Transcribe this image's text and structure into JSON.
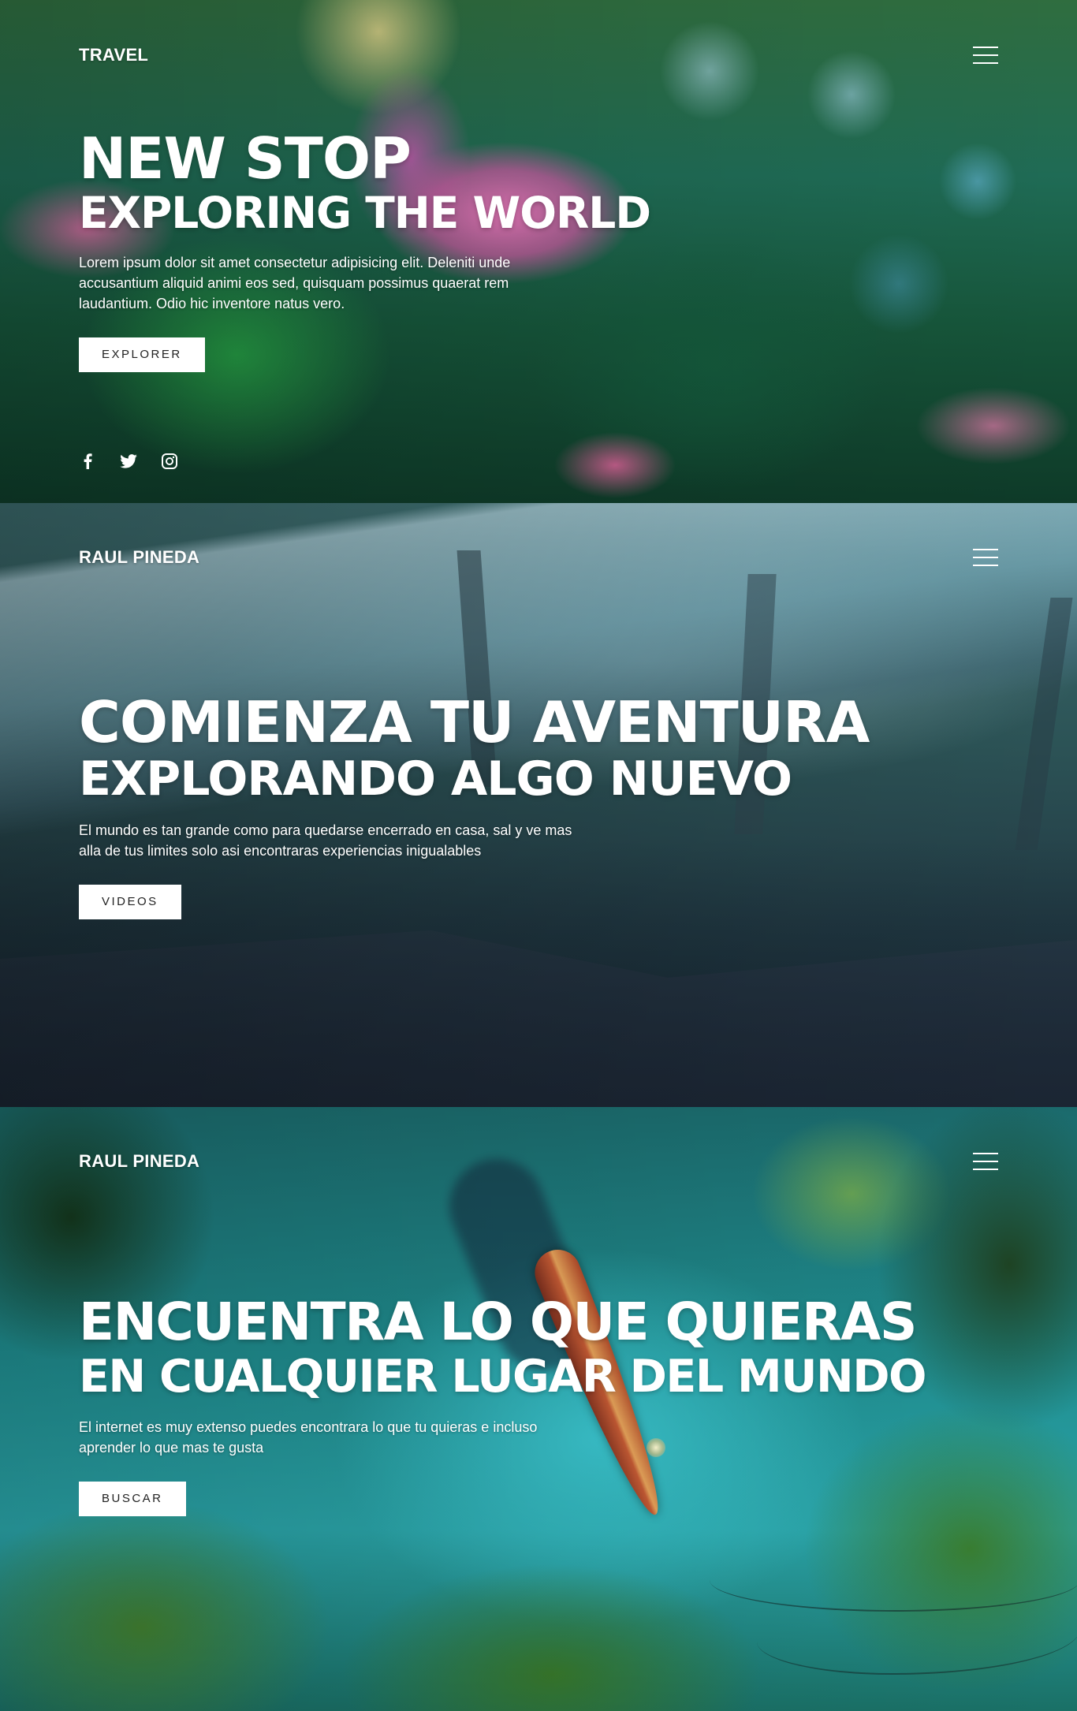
{
  "sections": [
    {
      "brand": "TRAVEL",
      "title_line1": "NEW STOP",
      "title_line2": "EXPLORING THE WORLD",
      "description_lines": [
        "Lorem ipsum dolor sit amet consectetur adipisicing elit. Deleniti unde",
        "accusantium aliquid animi eos sed, quisquam possimus quaerat rem",
        "laudantium. Odio hic inventore natus vero."
      ],
      "button_label": "EXPLORER",
      "social_icons": [
        "facebook-icon",
        "twitter-icon",
        "instagram-icon"
      ],
      "menu_icon": "hamburger-menu-icon"
    },
    {
      "brand": "RAUL PINEDA",
      "title_line1": "COMIENZA TU AVENTURA",
      "title_line2": "EXPLORANDO ALGO NUEVO",
      "description_lines": [
        "El mundo es tan grande como para quedarse encerrado en casa, sal y ve mas",
        "alla de tus limites solo asi encontraras experiencias inigualables"
      ],
      "button_label": "VIDEOS",
      "menu_icon": "hamburger-menu-icon"
    },
    {
      "brand": "RAUL PINEDA",
      "title_line1": "ENCUENTRA LO QUE QUIERAS",
      "title_line2": "EN CUALQUIER LUGAR DEL MUNDO",
      "description_lines": [
        "El internet es muy extenso puedes encontrara lo que tu quieras e incluso",
        "aprender lo que mas te gusta"
      ],
      "button_label": "BUSCAR",
      "menu_icon": "hamburger-menu-icon"
    }
  ],
  "colors": {
    "text": "#ffffff",
    "button_bg": "#ffffff",
    "button_text": "#222222"
  }
}
